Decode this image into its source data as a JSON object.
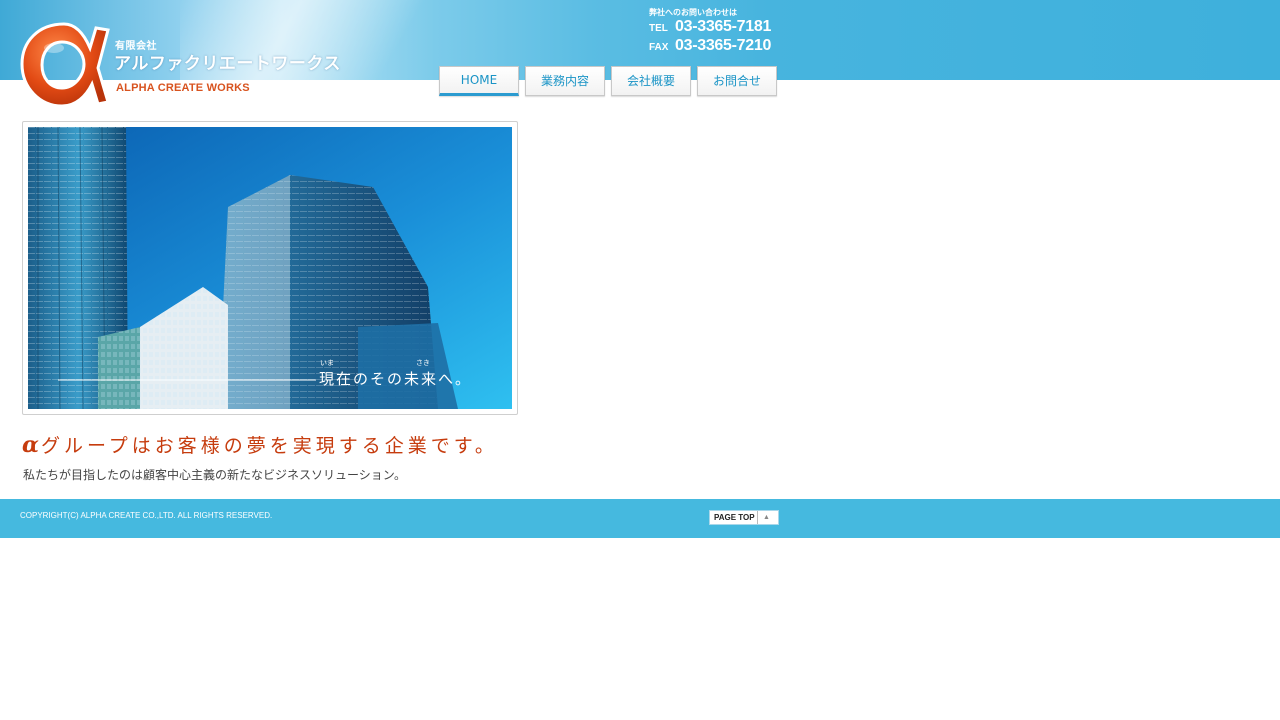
{
  "header": {
    "logo_sub": "有限会社",
    "logo_title": "アルファクリエートワークス",
    "logo_en": "ALPHA CREATE WORKS",
    "contact_label": "弊社へのお問い合わせは",
    "tel_label": "TEL",
    "tel": "03-3365-7181",
    "fax_label": "FAX",
    "fax": "03-3365-7210",
    "brand_color": "#d8531f"
  },
  "nav": {
    "items": [
      {
        "label": "HOME",
        "active": true
      },
      {
        "label": "業務内容"
      },
      {
        "label": "会社概要"
      },
      {
        "label": "お問合せ"
      }
    ]
  },
  "hero": {
    "caption": "現在のその未来へ。",
    "ruby_ima": "いま",
    "ruby_saki": "さき"
  },
  "main": {
    "tagline_alpha": "α",
    "tagline": "グループはお客様の夢を実現する企業です。",
    "subtitle": "私たちが目指したのは顧客中心主義の新たなビジネスソリューション。"
  },
  "footer": {
    "copyright": "COPYRIGHT(C) ALPHA CREATE CO.,LTD. ALL RIGHTS RESERVED.",
    "pagetop_label": "PAGE TOP",
    "pagetop_icon": "triangle-up-icon"
  }
}
